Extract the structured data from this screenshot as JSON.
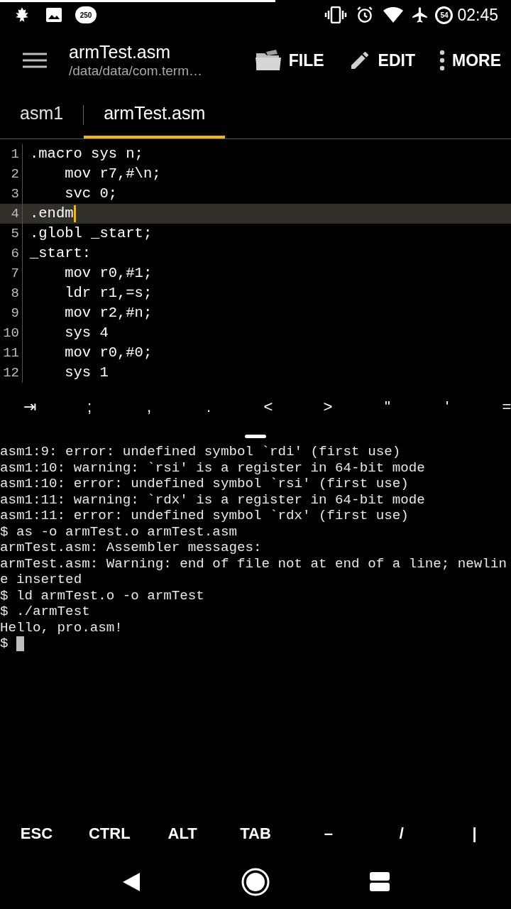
{
  "status_bar": {
    "notification_badge": "250",
    "battery": "54",
    "time": "02:45"
  },
  "app_bar": {
    "title": "armTest.asm",
    "subtitle": "/data/data/com.term…",
    "actions": [
      {
        "kind": "file",
        "label": "FILE"
      },
      {
        "kind": "edit",
        "label": "EDIT"
      },
      {
        "kind": "more",
        "label": "MORE"
      }
    ]
  },
  "tabs": [
    {
      "label": "asm1",
      "selected": false
    },
    {
      "label": "armTest.asm",
      "selected": true
    }
  ],
  "editor": {
    "lines": [
      {
        "number": "1",
        "code": ".macro sys n;",
        "current": false
      },
      {
        "number": "2",
        "code": "    mov r7,#\\n;",
        "current": false
      },
      {
        "number": "3",
        "code": "    svc 0;",
        "current": false
      },
      {
        "number": "4",
        "code": ".endm",
        "current": true
      },
      {
        "number": "5",
        "code": ".globl _start;",
        "current": false
      },
      {
        "number": "6",
        "code": "_start:",
        "current": false
      },
      {
        "number": "7",
        "code": "    mov r0,#1;",
        "current": false
      },
      {
        "number": "8",
        "code": "    ldr r1,=s;",
        "current": false
      },
      {
        "number": "9",
        "code": "    mov r2,#n;",
        "current": false
      },
      {
        "number": "10",
        "code": "    sys 4",
        "current": false
      },
      {
        "number": "11",
        "code": "    mov r0,#0;",
        "current": false
      },
      {
        "number": "12",
        "code": "    sys 1",
        "current": false
      }
    ]
  },
  "symbol_bar": [
    [
      "⇥",
      ";"
    ],
    [
      ",",
      "."
    ],
    [
      "<",
      ">"
    ],
    [
      "\"",
      "'"
    ],
    [
      "="
    ]
  ],
  "terminal": {
    "lines": [
      "asm1:9: error: undefined symbol `rdi' (first use)",
      "asm1:10: warning: `rsi' is a register in 64-bit mode",
      "asm1:10: error: undefined symbol `rsi' (first use)",
      "asm1:11: warning: `rdx' is a register in 64-bit mode",
      "asm1:11: error: undefined symbol `rdx' (first use)",
      "$ as -o armTest.o armTest.asm",
      "armTest.asm: Assembler messages:",
      "armTest.asm: Warning: end of file not at end of a line; newline inserted",
      "$ ld armTest.o -o armTest",
      "$ ./armTest",
      "Hello, pro.asm!"
    ],
    "prompt": "$"
  },
  "extra_keys": [
    "ESC",
    "CTRL",
    "ALT",
    "TAB",
    "–",
    "/",
    "|"
  ]
}
